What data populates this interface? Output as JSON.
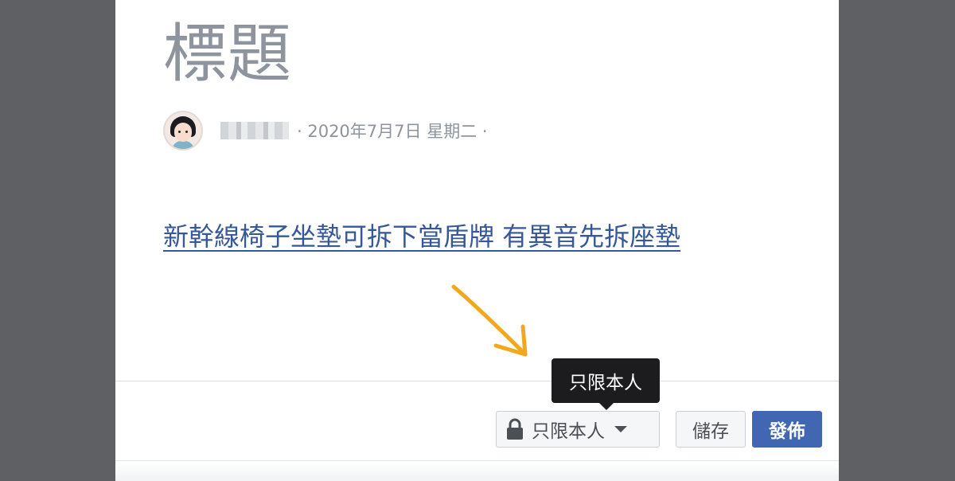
{
  "post": {
    "title": "標題",
    "meta_text": "· 2020年7月7日 星期二 ·",
    "link_text": "新幹線椅子坐墊可拆下當盾牌 有異音先拆座墊"
  },
  "tooltip": {
    "text": "只限本人"
  },
  "footer": {
    "privacy_label": "只限本人",
    "save_label": "儲存",
    "publish_label": "發佈"
  },
  "icons": {
    "privacy": "lock-icon",
    "dropdown": "caret-down-icon",
    "annotation": "arrow-icon"
  },
  "colors": {
    "publish_button": "#4267b2",
    "link": "#365899",
    "annotation_arrow": "#f2a81d"
  }
}
